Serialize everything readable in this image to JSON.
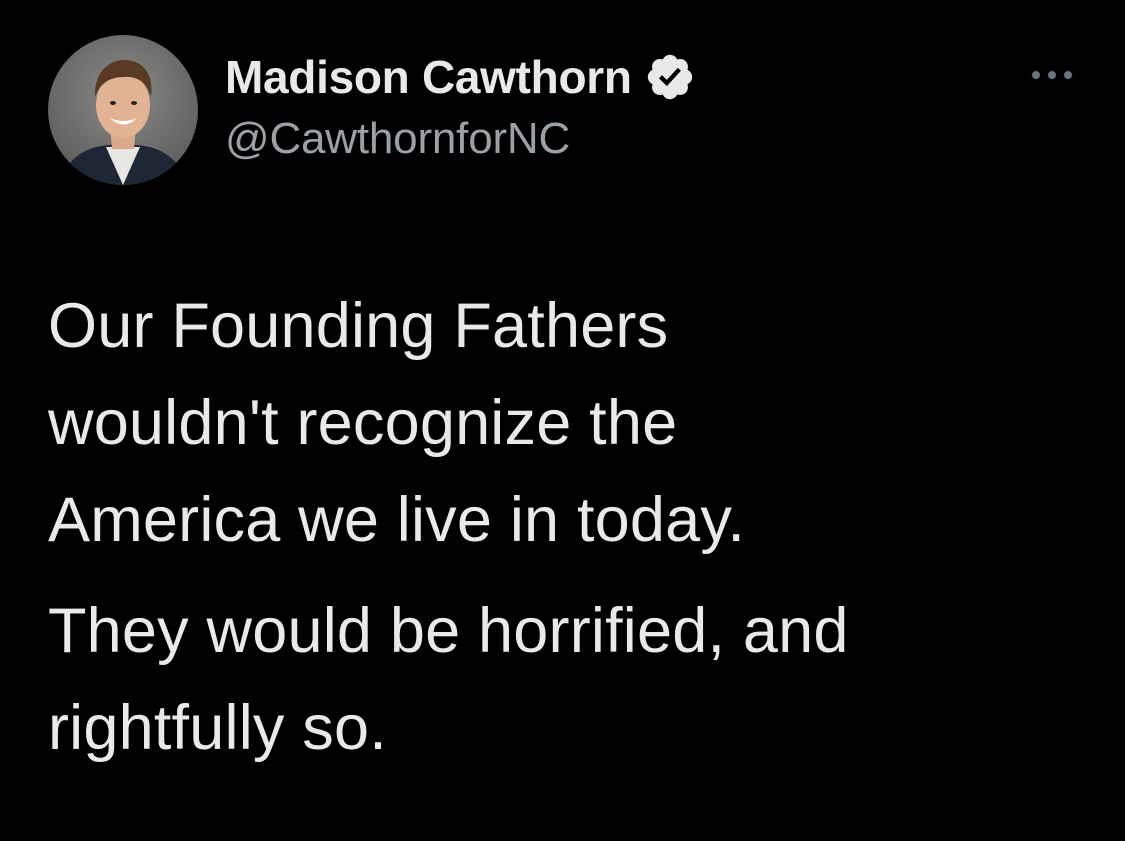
{
  "author": {
    "display_name": "Madison Cawthorn",
    "handle": "@CawthornforNC",
    "verified": true,
    "avatar_icon": "profile-photo"
  },
  "menu": {
    "icon": "more-horizontal-icon"
  },
  "tweet": {
    "paragraphs": [
      "Our Founding Fathers\nwouldn't recognize the\nAmerica we live in today.",
      "They would be horrified, and\nrightfully so."
    ]
  },
  "colors": {
    "background": "#000000",
    "text_primary": "#e7e9ea",
    "text_secondary": "#9aa0a6",
    "verified_badge": "#e7e9ea"
  }
}
